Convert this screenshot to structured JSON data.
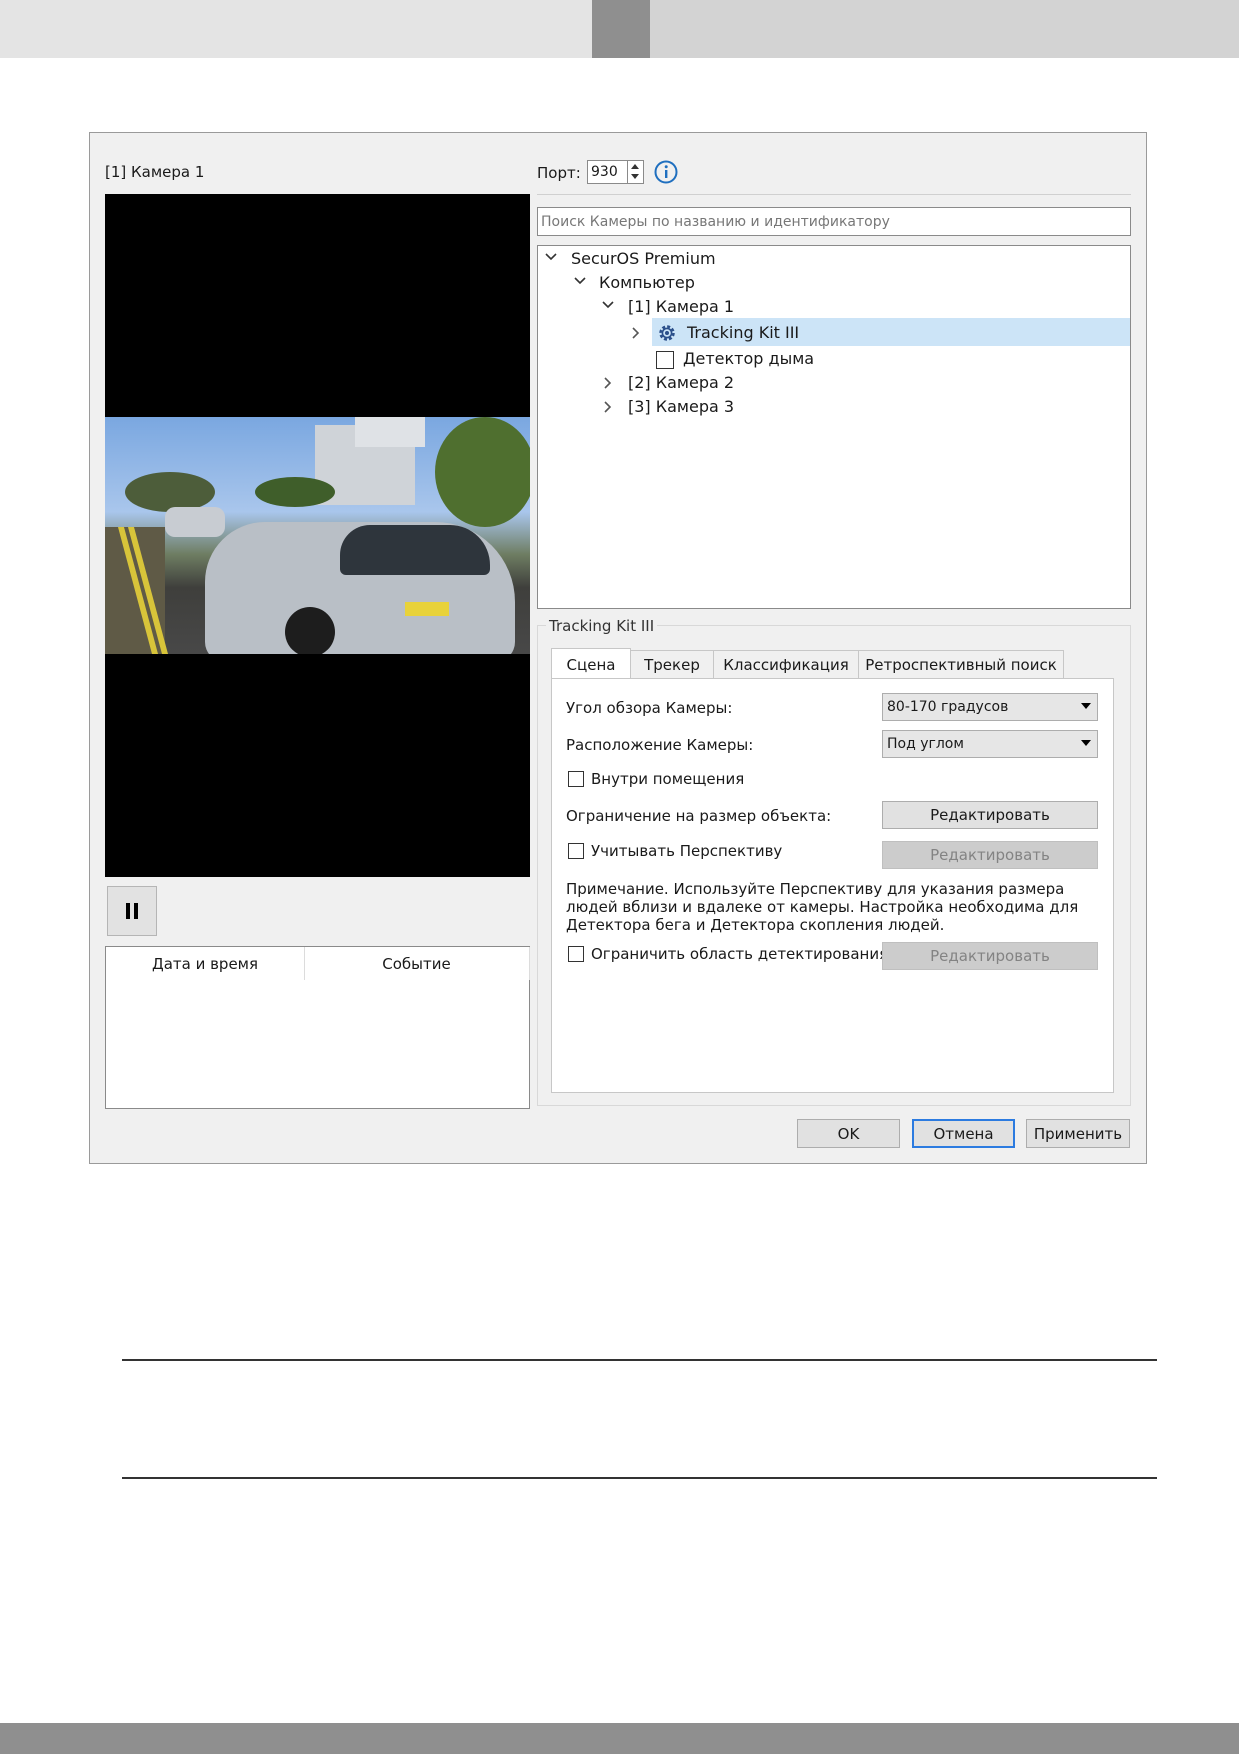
{
  "camera_title": "[1] Камера 1",
  "port": {
    "label": "Порт:",
    "value": "930"
  },
  "search": {
    "placeholder": "Поиск Камеры по названию и идентификатору"
  },
  "tree": {
    "root": "SecurOS Premium",
    "computer": "Компьютер",
    "camera1": "[1] Камера 1",
    "tracking": "Tracking Kit III",
    "smoke": "Детектор дыма",
    "camera2": "[2] Камера 2",
    "camera3": "[3] Камера 3"
  },
  "events": {
    "col_datetime": "Дата и время",
    "col_event": "Событие"
  },
  "group_title": "Tracking Kit III",
  "tabs": [
    "Сцена",
    "Трекер",
    "Классификация",
    "Ретроспективный поиск"
  ],
  "scene": {
    "fov_label": "Угол обзора Камеры:",
    "fov_value": "80-170 градусов",
    "position_label": "Расположение Камеры:",
    "position_value": "Под углом",
    "indoor_label": "Внутри помещения",
    "size_limit_label": "Ограничение на размер объекта:",
    "edit_label": "Редактировать",
    "perspective_label": "Учитывать Перспективу",
    "note_text": "Примечание. Используйте Перспективу для указания размера людей вблизи и вдалеке от камеры. Настройка необходима для Детектора бега и Детектора скопления людей.",
    "limit_area_label": "Ограничить область детектирования"
  },
  "buttons": {
    "ok": "OK",
    "cancel": "Отмена",
    "apply": "Применить"
  }
}
